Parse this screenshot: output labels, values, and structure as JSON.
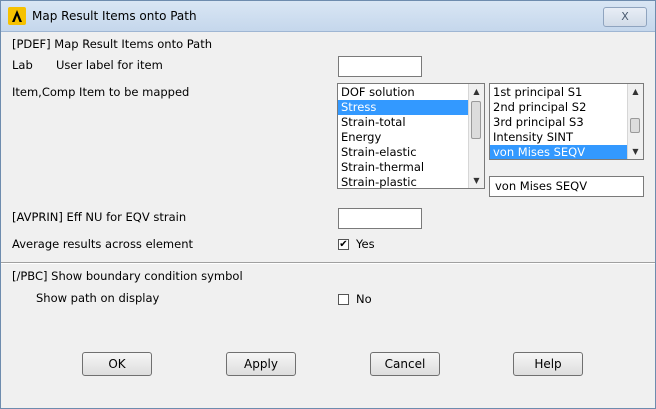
{
  "window": {
    "title": "Map Result Items onto Path",
    "close_label": "X"
  },
  "pdef": {
    "header": "[PDEF]  Map Result Items onto Path",
    "lab_label": "Lab",
    "lab_desc": "User label for item",
    "lab_value": "",
    "item_label": "Item,Comp  Item to be mapped",
    "items": [
      "DOF solution",
      "Stress",
      "Strain-total",
      "Energy",
      "Strain-elastic",
      "Strain-thermal",
      "Strain-plastic"
    ],
    "selected_item_index": 1,
    "components": [
      "1st principal S1",
      "2nd principal S2",
      "3rd principal S3",
      "Intensity  SINT",
      "von Mises  SEQV"
    ],
    "selected_component_index": 4,
    "component_value": "von Mises  SEQV"
  },
  "avprin": {
    "label": "[AVPRIN]  Eff NU for EQV strain",
    "value": ""
  },
  "average": {
    "label": "Average results across element",
    "checked": true,
    "check_mark": "✔",
    "option_text": "Yes"
  },
  "pbc": {
    "header": "[/PBC]  Show boundary condition symbol",
    "show_path_label": "Show path on display",
    "checked": false,
    "option_text": "No"
  },
  "buttons": {
    "ok": "OK",
    "apply": "Apply",
    "cancel": "Cancel",
    "help": "Help"
  },
  "icons": {
    "app": "ansys-logo-icon",
    "scroll_up": "▲",
    "scroll_down": "▼"
  }
}
